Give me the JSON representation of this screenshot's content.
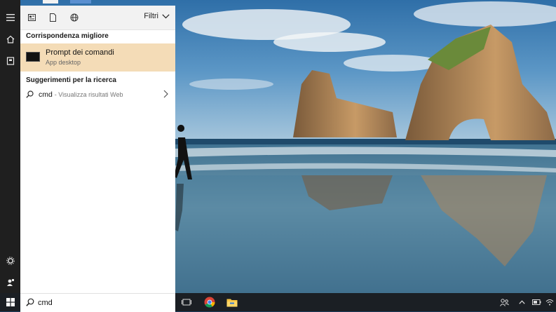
{
  "panel": {
    "filters_label": "Filtri",
    "best_match_title": "Corrispondenza migliore",
    "best_match": {
      "name": "Prompt dei comandi",
      "type": "App desktop"
    },
    "suggestions_title": "Suggerimenti per la ricerca",
    "suggestion": {
      "query": "cmd",
      "desc": "- Visualizza risultati Web"
    }
  },
  "search": {
    "value": "cmd"
  },
  "colors": {
    "best_match_bg": "#f4dcb7",
    "rail_bg": "#1f1f1f",
    "taskbar_bg": "#1b1f24"
  },
  "icons": {
    "rail": [
      "hamburger-icon",
      "home-icon",
      "notebook-icon",
      "settings-icon",
      "user-feedback-icon"
    ],
    "panel_top": [
      "news-icon",
      "document-icon",
      "globe-icon"
    ],
    "taskbar": [
      "windows-start-icon",
      "task-view-icon",
      "chrome-icon",
      "file-explorer-icon"
    ],
    "tray": [
      "people-icon",
      "chevron-up-icon",
      "battery-icon",
      "wifi-icon"
    ]
  }
}
